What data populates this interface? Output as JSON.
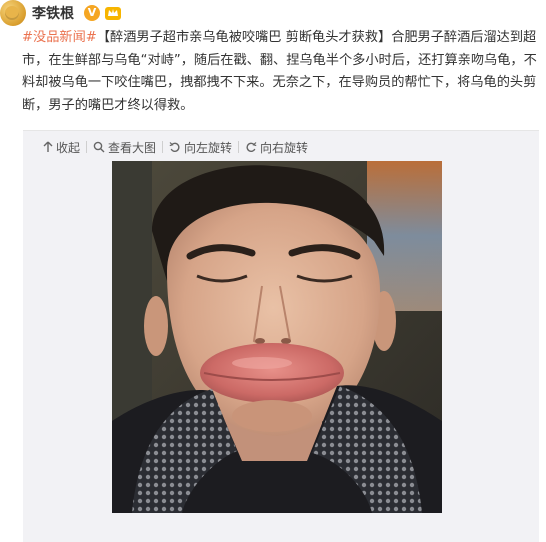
{
  "header": {
    "username": "李铁根",
    "verified_mark": "V"
  },
  "post": {
    "hashtag": "#没品新闻#",
    "title": "【醉酒男子超市亲乌龟被咬嘴巴 剪断龟头才获救】",
    "body": "合肥男子醉酒后溜达到超市，在生鲜部与乌龟“对峙”，随后在戳、翻、捏乌龟半个多小时后，还打算亲吻乌龟，不料却被乌龟一下咬住嘴巴，拽都拽不下来。无奈之下，在导购员的帮忙下，将乌龟的头剪断，男子的嘴巴才终以得救。"
  },
  "toolbar": {
    "collapse": "收起",
    "view_large": "查看大图",
    "rotate_left": "向左旋转",
    "rotate_right": "向右旋转"
  },
  "colors": {
    "hashtag": "#eb7350",
    "text": "#333333",
    "verified": "#f5a623"
  }
}
